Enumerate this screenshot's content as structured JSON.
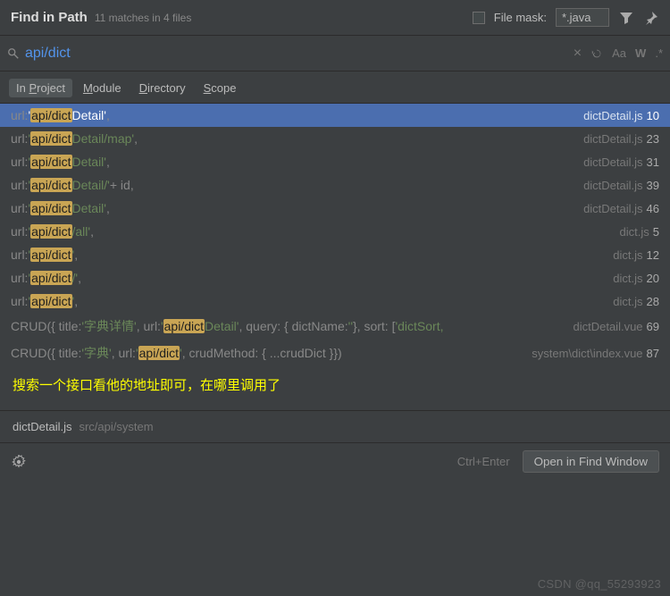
{
  "header": {
    "title": "Find in Path",
    "subtitle": "11 matches in 4 files",
    "filemask_label": "File mask:",
    "filemask_value": "*.java"
  },
  "search": {
    "value": "api/dict",
    "case_label": "Aa",
    "word_label": "W",
    "regex_label": ".*"
  },
  "tabs": [
    {
      "label_pre": "In ",
      "label_u": "P",
      "label_post": "roject",
      "active": true
    },
    {
      "label_pre": "",
      "label_u": "M",
      "label_post": "odule",
      "active": false
    },
    {
      "label_pre": "",
      "label_u": "D",
      "label_post": "irectory",
      "active": false
    },
    {
      "label_pre": "",
      "label_u": "S",
      "label_post": "cope",
      "active": false
    }
  ],
  "results": [
    {
      "selected": true,
      "prefix": "url: '",
      "match": "api/dict",
      "suffix_green": "Detail'",
      "suffix_plain": ",",
      "file": "dictDetail.js",
      "line": "10"
    },
    {
      "selected": false,
      "prefix": "url: '",
      "match": "api/dict",
      "suffix_green": "Detail/map'",
      "suffix_plain": ",",
      "file": "dictDetail.js",
      "line": "23"
    },
    {
      "selected": false,
      "prefix": "url: '",
      "match": "api/dict",
      "suffix_green": "Detail'",
      "suffix_plain": ",",
      "file": "dictDetail.js",
      "line": "31"
    },
    {
      "selected": false,
      "prefix": "url: '",
      "match": "api/dict",
      "suffix_green": "Detail/'",
      "suffix_plain": " + id,",
      "file": "dictDetail.js",
      "line": "39"
    },
    {
      "selected": false,
      "prefix": "url: '",
      "match": "api/dict",
      "suffix_green": "Detail'",
      "suffix_plain": ",",
      "file": "dictDetail.js",
      "line": "46"
    },
    {
      "selected": false,
      "prefix": "url: '",
      "match": "api/dict",
      "suffix_green": "/all'",
      "suffix_plain": ",",
      "file": "dict.js",
      "line": "5"
    },
    {
      "selected": false,
      "prefix": "url: '",
      "match": "api/dict",
      "suffix_green": "'",
      "suffix_plain": ",",
      "file": "dict.js",
      "line": "12"
    },
    {
      "selected": false,
      "prefix": "url: '",
      "match": "api/dict",
      "suffix_green": "/'",
      "suffix_plain": ",",
      "file": "dict.js",
      "line": "20"
    },
    {
      "selected": false,
      "prefix": "url: '",
      "match": "api/dict",
      "suffix_green": "'",
      "suffix_plain": ",",
      "file": "dict.js",
      "line": "28"
    }
  ],
  "long_results": [
    {
      "pre": "CRUD({ title: ",
      "s1": "'字典详情'",
      "mid1": ", url: '",
      "match": "api/dict",
      "sg": "Detail'",
      "mid2": ", query: { dictName: ",
      "s2": "''",
      "mid3": " }, sort: [",
      "s3": "'dictSort,",
      "file": "dictDetail.vue",
      "line": "69"
    },
    {
      "pre": "CRUD({ title: ",
      "s1": "'字典'",
      "mid1": ", url: '",
      "match": "api/dict",
      "sg": "'",
      "mid2": ", crudMethod: { ...crudDict }})",
      "s2": "",
      "mid3": "",
      "s3": "",
      "file": "system\\dict\\index.vue",
      "line": "87"
    }
  ],
  "annotation": "搜索一个接口看他的地址即可，在哪里调用了",
  "filebar": {
    "name": "dictDetail.js",
    "path": "src/api/system"
  },
  "footer": {
    "hint": "Ctrl+Enter",
    "button": "Open in Find Window"
  },
  "watermark": "CSDN @qq_55293923"
}
